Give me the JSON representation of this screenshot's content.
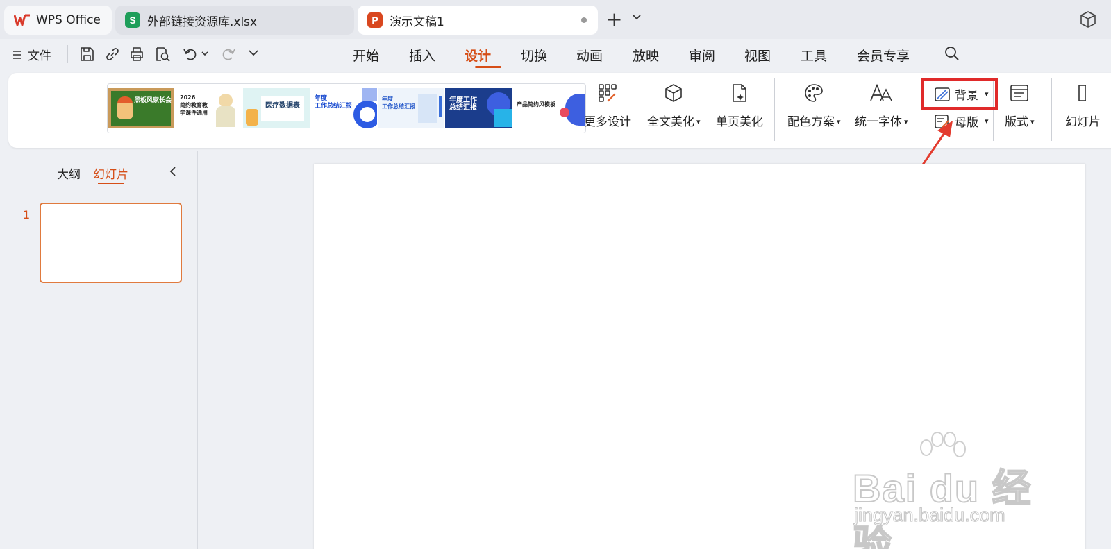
{
  "tabs": {
    "wps": {
      "label": "WPS Office",
      "color": "#d93a2b"
    },
    "xlsx": {
      "label": "外部链接资源库.xlsx",
      "badge": "S",
      "color": "#1e9e5a"
    },
    "ppt": {
      "label": "演示文稿1",
      "badge": "P",
      "color": "#d9471f"
    }
  },
  "menu": {
    "file_label": "文件",
    "tabs": [
      "开始",
      "插入",
      "设计",
      "切换",
      "动画",
      "放映",
      "审阅",
      "视图",
      "工具",
      "会员专享"
    ],
    "active_tab": "设计"
  },
  "ribbon": {
    "gallery_thumbs": [
      {
        "text": "黑板风家长会",
        "bg": "#3a7a2a"
      },
      {
        "text": "2026\n简约教育教\n学课件通用",
        "bg": "#ffffff"
      },
      {
        "text": "医疗数据表",
        "bg": "#dff3f3"
      },
      {
        "text": "年度\n工作总结汇报",
        "bg": "#ffffff"
      },
      {
        "text": "年度\n工作总结汇报",
        "bg": "#eef4fb"
      },
      {
        "text": "年度工作\n总结汇报",
        "bg": "#1b3d8c"
      },
      {
        "text": "产品简约风模板",
        "bg": "#ffffff"
      }
    ],
    "more_design": "更多设计",
    "full_beautify": "全文美化",
    "page_beautify": "单页美化",
    "color_scheme": "配色方案",
    "unify_font": "统一字体",
    "background": "背景",
    "master": "母版",
    "layout": "版式",
    "slide_size": "幻灯片"
  },
  "left_panel": {
    "outline_tab": "大纲",
    "slides_tab": "幻灯片",
    "slide_number": "1"
  },
  "watermark": {
    "brand": "Bai du 经验",
    "url": "jingyan.baidu.com"
  },
  "colors": {
    "accent": "#d64e17",
    "highlight": "#e02a2a"
  }
}
